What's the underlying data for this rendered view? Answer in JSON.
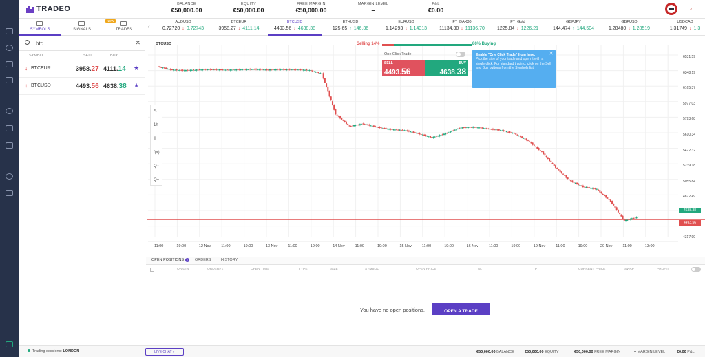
{
  "brand": "TRADEO",
  "header": {
    "stats": [
      {
        "label": "BALANCE",
        "value": "€50,000.00"
      },
      {
        "label": "EQUITY",
        "value": "€50,000.00"
      },
      {
        "label": "FREE MARGIN",
        "value": "€50,000.00"
      },
      {
        "label": "MARGIN LEVEL",
        "value": "–"
      },
      {
        "label": "P&L",
        "value": "€0.00"
      }
    ]
  },
  "left_tabs": [
    {
      "label": "SYMBOLS"
    },
    {
      "label": "SIGNALS",
      "badge": "NEW"
    },
    {
      "label": "TRADES"
    }
  ],
  "search": {
    "value": "btc"
  },
  "symbol_columns": [
    "SYMBOL",
    "SELL",
    "BUY"
  ],
  "symbols": [
    {
      "name": "BTCEUR",
      "sell_main": "3958.",
      "sell_big": "27",
      "buy_main": "4111.",
      "buy_big": "14",
      "star": "★"
    },
    {
      "name": "BTCUSD",
      "sell_main": "4493.",
      "sell_big": "56",
      "buy_main": "4638.",
      "buy_big": "38",
      "star": "★"
    }
  ],
  "tickers": [
    {
      "name": "AUDUSD",
      "sell": "0.72720",
      "buy": "0.72743",
      "sell_dir": "↓",
      "buy_dir": "↑"
    },
    {
      "name": "BTCEUR",
      "sell": "3958.27",
      "buy": "4111.14",
      "sell_dir": "↓",
      "buy_dir": "↓"
    },
    {
      "name": "BTCUSD",
      "sell": "4493.56",
      "buy": "4638.38",
      "sell_dir": "↓",
      "buy_dir": "↓"
    },
    {
      "name": "ETHUSD",
      "sell": "125.65",
      "buy": "146.36",
      "sell_dir": "↑",
      "buy_dir": "↑"
    },
    {
      "name": "EURUSD",
      "sell": "1.14293",
      "buy": "1.14313",
      "sell_dir": "↓",
      "buy_dir": "↑"
    },
    {
      "name": "FT_DAX30",
      "sell": "11134.30",
      "buy": "11136.70",
      "sell_dir": "↓",
      "buy_dir": "↑"
    },
    {
      "name": "FT_Gold",
      "sell": "1225.84",
      "buy": "1226.21",
      "sell_dir": "↓",
      "buy_dir": "↑"
    },
    {
      "name": "GBPJPY",
      "sell": "144.474",
      "buy": "144.504",
      "sell_dir": "↑",
      "buy_dir": "↓"
    },
    {
      "name": "GBPUSD",
      "sell": "1.28480",
      "buy": "1.28519",
      "sell_dir": "↓",
      "buy_dir": "↑"
    },
    {
      "name": "USDCAD",
      "sell": "1.31749",
      "buy": "1.3",
      "sell_dir": "↓",
      "buy_dir": "↑"
    }
  ],
  "chart": {
    "symbol": "BTCUSD",
    "selling": "Selling 14%",
    "buying": "86% Buying",
    "one_click_label": "One Click Trade",
    "sell_label": "SELL",
    "sell_main": "4493.",
    "sell_big": "56",
    "buy_label": "BUY",
    "buy_main": "4638.",
    "buy_big": "38",
    "tooltip_title": "Enable \"One Click Trade\" from here.",
    "tooltip_body": "Pick the size of your trade and open it with a single click. For standard trading, click on the Sell and Buy buttons from the Symbols list.",
    "tools": [
      "✎",
      "1h",
      "⫼",
      "f(x)",
      "Q−",
      "Q+"
    ],
    "price_tags": [
      {
        "value": "4638.38",
        "color": "#22a87e"
      },
      {
        "value": "4493.56",
        "color": "#e05050"
      }
    ]
  },
  "chart_data": {
    "type": "line",
    "title": "BTCUSD",
    "x": [
      "11:00",
      "19:00",
      "12 Nov",
      "11:00",
      "19:00",
      "13 Nov",
      "11:00",
      "19:00",
      "14 Nov",
      "11:00",
      "19:00",
      "15 Nov",
      "11:00",
      "19:00",
      "16 Nov",
      "11:00",
      "19:00",
      "19 Nov",
      "11:00",
      "19:00",
      "20 Nov",
      "11:00",
      "13:00"
    ],
    "y_ticks": [
      "6531.59",
      "6348.19",
      "6165.37",
      "5977.03",
      "5793.68",
      "5610.34",
      "5422.32",
      "5239.18",
      "5055.84",
      "4872.49",
      "4683.15",
      "4317.99"
    ],
    "series": [
      {
        "values": [
          6390,
          6350,
          6340,
          6348,
          6352,
          6346,
          6350,
          6355,
          6348,
          6352,
          6350,
          6345,
          6300,
          5800,
          5650,
          5680,
          5640,
          5610,
          5600,
          5560,
          5510,
          5560,
          5630,
          5640,
          5620,
          5600,
          5560,
          5470,
          5330,
          5140,
          4980,
          4900,
          4870,
          4720,
          4480,
          4530
        ]
      }
    ],
    "grid": true
  },
  "bottom_tabs": [
    "OPEN POSITIONS",
    "ORDERS",
    "HISTORY"
  ],
  "bottom_badge": "i",
  "table_headers": [
    "ORIGIN",
    "ORDER# ↓",
    "OPEN TIME",
    "TYPE",
    "SIZE",
    "SYMBOL",
    "OPEN PRICE",
    "SL",
    "TP",
    "CURRENT PRICE",
    "SWAP",
    "PROFIT"
  ],
  "empty_text": "You have no open positions.",
  "open_trade_button": "OPEN A TRADE",
  "footer": {
    "sessions_label": "Trading sessions:",
    "sessions_value": "LONDON",
    "live_chat": "LIVE CHAT",
    "stats": [
      {
        "value": "€50,000.00",
        "label": "BALANCE"
      },
      {
        "value": "€50,000.00",
        "label": "EQUITY"
      },
      {
        "value": "€50,000.00",
        "label": "FREE MARGIN"
      },
      {
        "value": "–",
        "label": "MARGIN LEVEL"
      },
      {
        "value": "€0.00",
        "label": "P&L"
      }
    ]
  }
}
